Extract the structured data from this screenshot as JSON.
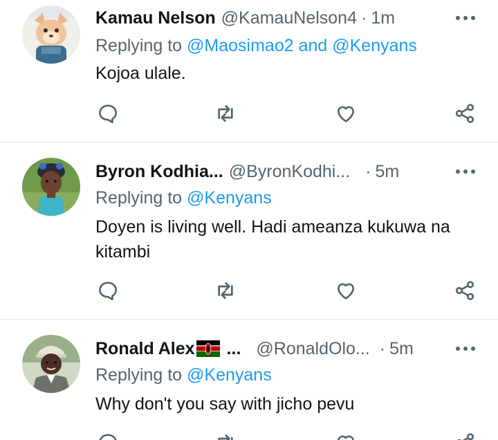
{
  "colors": {
    "text_primary": "#0f1419",
    "text_secondary": "#536471",
    "link": "#1d9bf0",
    "divider": "#e1e6ea"
  },
  "tweets": [
    {
      "name": "Kamau Nelson",
      "handle": "@KamauNelson4",
      "separator": "·",
      "time": "1m",
      "replying_prefix": "Replying to ",
      "replying_to": "@Maosimao2 and @Kenyans",
      "text": "Kojoa ulale.",
      "avatar_icon": "cat-avatar"
    },
    {
      "name": "Byron Kodhia...",
      "handle": "@ByronKodhi...",
      "separator": "·",
      "time": "5m",
      "replying_prefix": "Replying to ",
      "replying_to": "@Kenyans",
      "text": "Doyen is living well. Hadi ameanza kukuwa na kitambi",
      "avatar_icon": "child-avatar"
    },
    {
      "name": "Ronald Alex",
      "name_suffix": "...",
      "handle": "@RonaldOlo...",
      "separator": "·",
      "time": "5m",
      "replying_prefix": "Replying to ",
      "replying_to": "@Kenyans",
      "text": "Why don't you say with jicho pevu",
      "avatar_icon": "man-cap-avatar",
      "name_badge": "kenya-flag-emoji"
    }
  ],
  "icons": {
    "more": "more-icon",
    "reply": "reply-icon",
    "retweet": "retweet-icon",
    "like": "like-icon",
    "share": "share-icon"
  }
}
